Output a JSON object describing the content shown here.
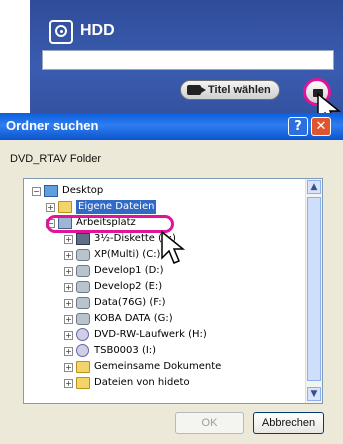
{
  "app_panel": {
    "device_title": "HDD",
    "device_value": "",
    "select_title_button": "Titel wählen"
  },
  "dialog": {
    "title": "Ordner suchen",
    "help_label": "?",
    "close_label": "✕",
    "description": "DVD_RTAV Folder",
    "ok_label": "OK",
    "cancel_label": "Abbrechen"
  },
  "tree": [
    {
      "label": "Desktop",
      "expander": "−",
      "icon": "desktop-icon"
    },
    {
      "label": "Eigene Dateien",
      "expander": "+",
      "icon": "folder-icon",
      "selected": true
    },
    {
      "label": "Arbeitsplatz",
      "expander": "−",
      "icon": "computer-icon"
    },
    {
      "label": "3½-Diskette (A:)",
      "expander": "+",
      "icon": "floppy-icon"
    },
    {
      "label": "XP(Multi) (C:)",
      "expander": "+",
      "icon": "drive-icon"
    },
    {
      "label": "Develop1 (D:)",
      "expander": "+",
      "icon": "drive-icon"
    },
    {
      "label": "Develop2 (E:)",
      "expander": "+",
      "icon": "drive-icon"
    },
    {
      "label": "Data(76G) (F:)",
      "expander": "+",
      "icon": "drive-icon"
    },
    {
      "label": "KOBA DATA (G:)",
      "expander": "+",
      "icon": "drive-icon"
    },
    {
      "label": "DVD-RW-Laufwerk (H:)",
      "expander": "+",
      "icon": "cdrom-icon"
    },
    {
      "label": "TSB0003 (I:)",
      "expander": "+",
      "icon": "cdrom-icon"
    },
    {
      "label": "Gemeinsame Dokumente",
      "expander": "+",
      "icon": "folder-icon"
    },
    {
      "label": "Dateien von hideto",
      "expander": "+",
      "icon": "folder-icon"
    }
  ],
  "colors": {
    "highlight_ring": "#e0139a",
    "selection": "#316ac5",
    "titlebar": "#0a5fdc"
  }
}
